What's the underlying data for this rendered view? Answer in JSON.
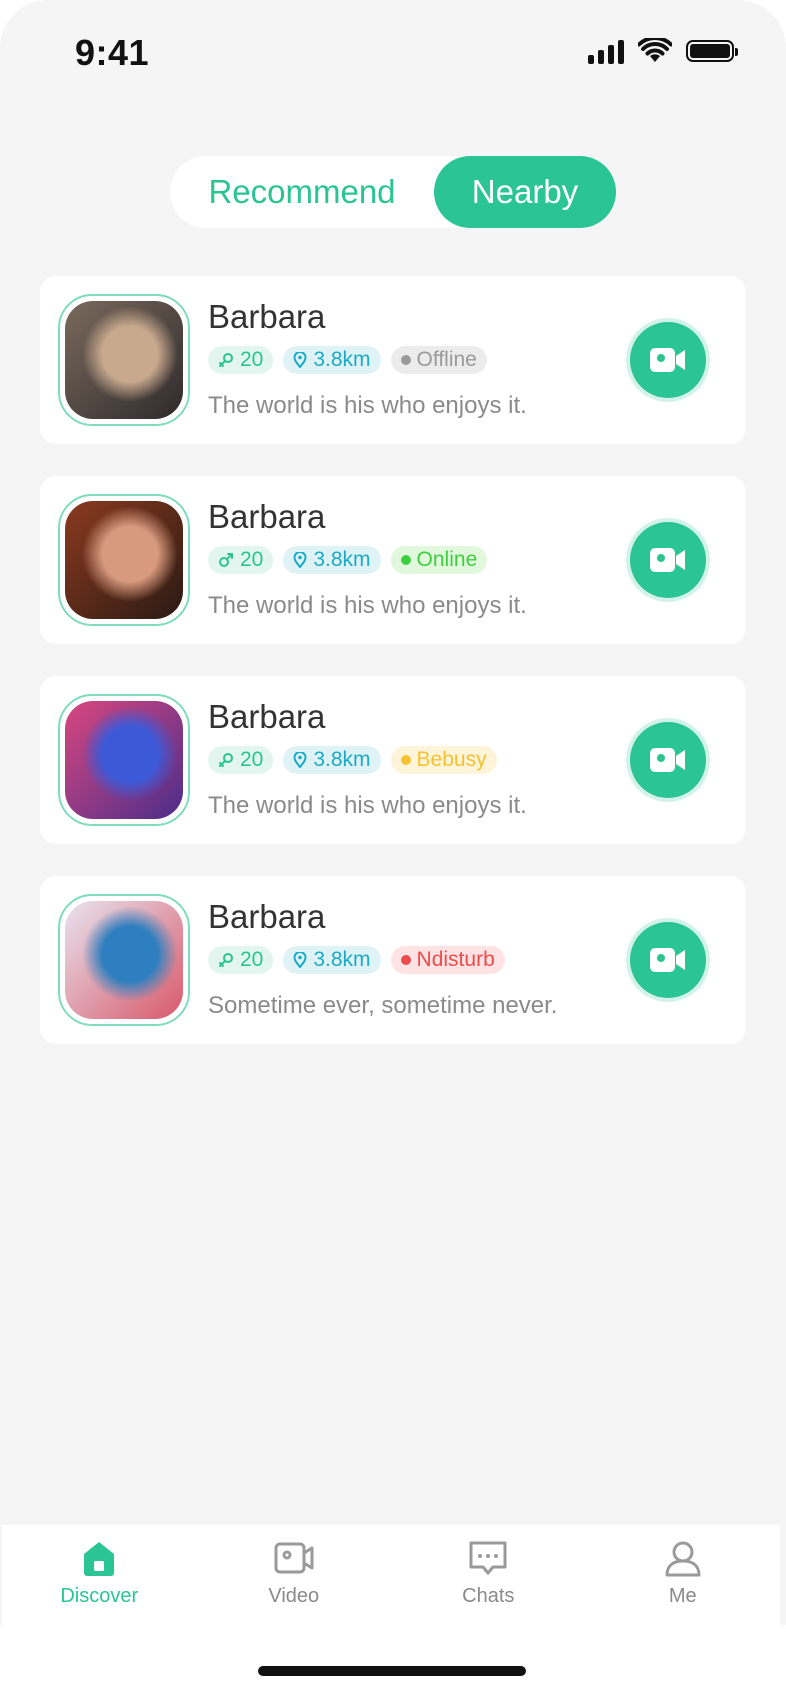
{
  "status_bar": {
    "time": "9:41"
  },
  "tabs": {
    "recommend": "Recommend",
    "nearby": "Nearby",
    "active": "Nearby"
  },
  "users": [
    {
      "name": "Barbara",
      "gender_icon": "female-icon",
      "age": "20",
      "distance": "3.8km",
      "status": "Offline",
      "status_color": "#9a9a9a",
      "status_bg": "#ececec",
      "motto": "The world is his who enjoys it.",
      "avatar_colors": [
        "#7a6a5c",
        "#2e2a2b",
        "#c9a98e"
      ]
    },
    {
      "name": "Barbara",
      "gender_icon": "male-icon",
      "age": "20",
      "distance": "3.8km",
      "status": "Online",
      "status_color": "#3ecf3e",
      "status_bg": "#e1f8dc",
      "motto": "The world is his who enjoys it.",
      "avatar_colors": [
        "#8b3a1f",
        "#2a1a14",
        "#d79a7e"
      ]
    },
    {
      "name": "Barbara",
      "gender_icon": "female-icon",
      "age": "20",
      "distance": "3.8km",
      "status": "Bebusy",
      "status_color": "#f5c231",
      "status_bg": "#fdf4da",
      "motto": "The world is his who enjoys it.",
      "avatar_colors": [
        "#d8477f",
        "#4b2d8a",
        "#3c5ad8"
      ]
    },
    {
      "name": "Barbara",
      "gender_icon": "female-icon",
      "age": "20",
      "distance": "3.8km",
      "status": "Ndisturb",
      "status_color": "#ef4b4b",
      "status_bg": "#fde3e3",
      "motto": "Sometime ever, sometime never.",
      "avatar_colors": [
        "#e8e4ef",
        "#d8596a",
        "#2e7fbf"
      ]
    }
  ],
  "nav": [
    {
      "label": "Discover",
      "icon": "home-icon",
      "active": true
    },
    {
      "label": "Video",
      "icon": "video-icon",
      "active": false
    },
    {
      "label": "Chats",
      "icon": "chat-icon",
      "active": false
    },
    {
      "label": "Me",
      "icon": "user-icon",
      "active": false
    }
  ],
  "colors": {
    "accent": "#2bc493",
    "background": "#f5f5f5"
  }
}
